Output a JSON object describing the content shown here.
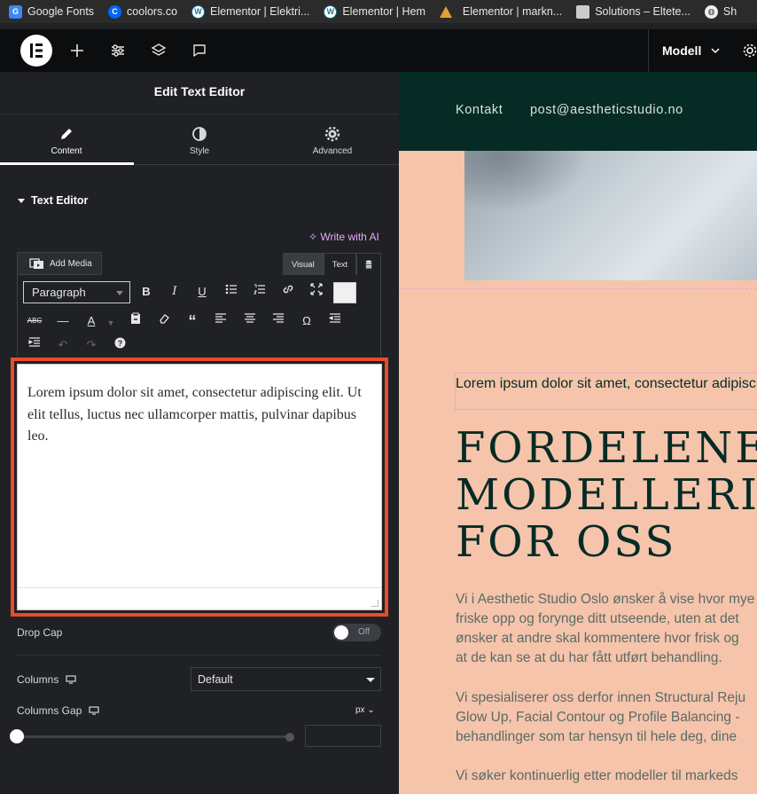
{
  "bookmarks": [
    {
      "label": "Google Fonts",
      "icon": "google-fonts-icon"
    },
    {
      "label": "coolors.co",
      "icon": "coolors-icon"
    },
    {
      "label": "Elementor | Elektri...",
      "icon": "wordpress-icon"
    },
    {
      "label": "Elementor | Hem",
      "icon": "wordpress-icon"
    },
    {
      "label": "Elementor | markn...",
      "icon": "elementor-triangle-icon"
    },
    {
      "label": "Solutions – Eltete...",
      "icon": "page-icon"
    },
    {
      "label": "Sh",
      "icon": "globe-icon"
    }
  ],
  "topbar": {
    "page_label": "Modell"
  },
  "panel": {
    "title": "Edit Text Editor",
    "tabs": [
      {
        "label": "Content",
        "icon": "pencil-icon",
        "active": true
      },
      {
        "label": "Style",
        "icon": "contrast-icon",
        "active": false
      },
      {
        "label": "Advanced",
        "icon": "gear-icon",
        "active": false
      }
    ],
    "section_title": "Text Editor",
    "ai_link": "✧ Write with AI",
    "add_media": "Add Media",
    "mode_tabs": {
      "visual": "Visual",
      "text": "Text"
    },
    "format_select": "Paragraph",
    "editor_content": "Lorem ipsum dolor sit amet, consectetur adipiscing elit. Ut elit tellus, luctus nec ullamcorper mattis, pulvinar dapibus leo.",
    "drop_cap": {
      "label": "Drop Cap",
      "state": "Off"
    },
    "columns": {
      "label": "Columns",
      "value": "Default"
    },
    "columns_gap": {
      "label": "Columns Gap",
      "unit": "px",
      "value": ""
    }
  },
  "preview": {
    "nav": [
      "Kontakt",
      "post@aestheticstudio.no"
    ],
    "lorem_line": "Lorem ipsum dolor sit amet, consectetur adipiscing",
    "heading_lines": [
      "FORDELENE VED",
      "MODELLERING",
      "FOR OSS"
    ],
    "paragraphs": [
      [
        "Vi i Aesthetic Studio Oslo ønsker å vise hvor mye",
        "friske opp og forynge ditt utseende, uten at det",
        "ønsker at andre skal kommentere hvor frisk og",
        "at de kan se at du har fått utført behandling."
      ],
      [
        "Vi spesialiserer oss derfor innen Structural Reju",
        "Glow Up, Facial Contour og Profile Balancing -",
        "behandlinger som tar hensyn til hele deg, dine"
      ],
      [
        "Vi søker kontinuerlig etter modeller til markeds"
      ]
    ]
  },
  "colors": {
    "accent_red": "#ea4b2b",
    "panel_bg": "#1f2124",
    "preview_bg": "#f5c4ab",
    "header_green": "#062b25",
    "ai_purple": "#e7a6ff"
  }
}
